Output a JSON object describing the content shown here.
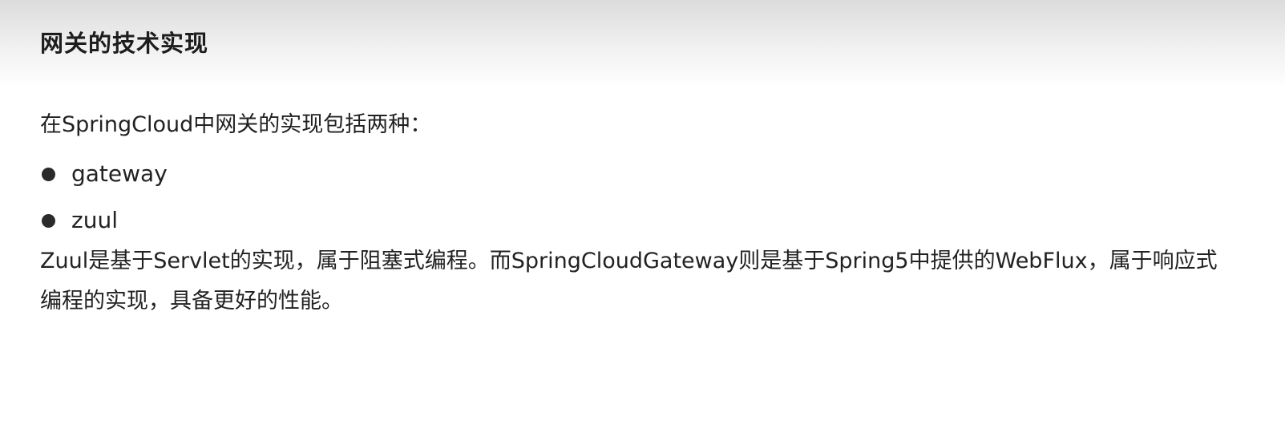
{
  "document": {
    "title": "网关的技术实现",
    "intro": "在SpringCloud中网关的实现包括两种：",
    "bullets": [
      {
        "text": "gateway"
      },
      {
        "text": "zuul"
      }
    ],
    "paragraph": "Zuul是基于Servlet的实现，属于阻塞式编程。而SpringCloudGateway则是基于Spring5中提供的WebFlux，属于响应式编程的实现，具备更好的性能。"
  }
}
